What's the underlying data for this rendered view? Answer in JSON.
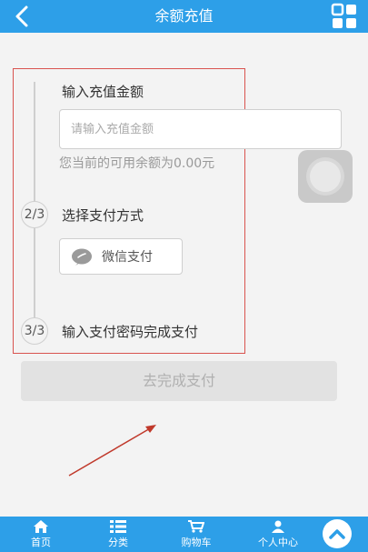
{
  "header": {
    "title": "余额充值"
  },
  "steps": [
    {
      "title": "输入充值金额"
    },
    {
      "num": "2/3",
      "title": "选择支付方式"
    },
    {
      "num": "3/3",
      "title": "输入支付密码完成支付"
    }
  ],
  "amount": {
    "placeholder": "请输入充值金额",
    "value": ""
  },
  "balance_note": "您当前的可用余额为0.00元",
  "payment_method": {
    "label": "微信支付"
  },
  "pay_button": {
    "label": "去完成支付"
  },
  "tabbar": [
    {
      "label": "首页",
      "icon": "home-icon"
    },
    {
      "label": "分类",
      "icon": "list-icon"
    },
    {
      "label": "购物车",
      "icon": "cart-icon"
    },
    {
      "label": "个人中心",
      "icon": "user-icon"
    }
  ],
  "colors": {
    "primary": "#2d9fe8",
    "highlight_border": "#d9534f",
    "annotation_arrow": "#c0392b"
  }
}
